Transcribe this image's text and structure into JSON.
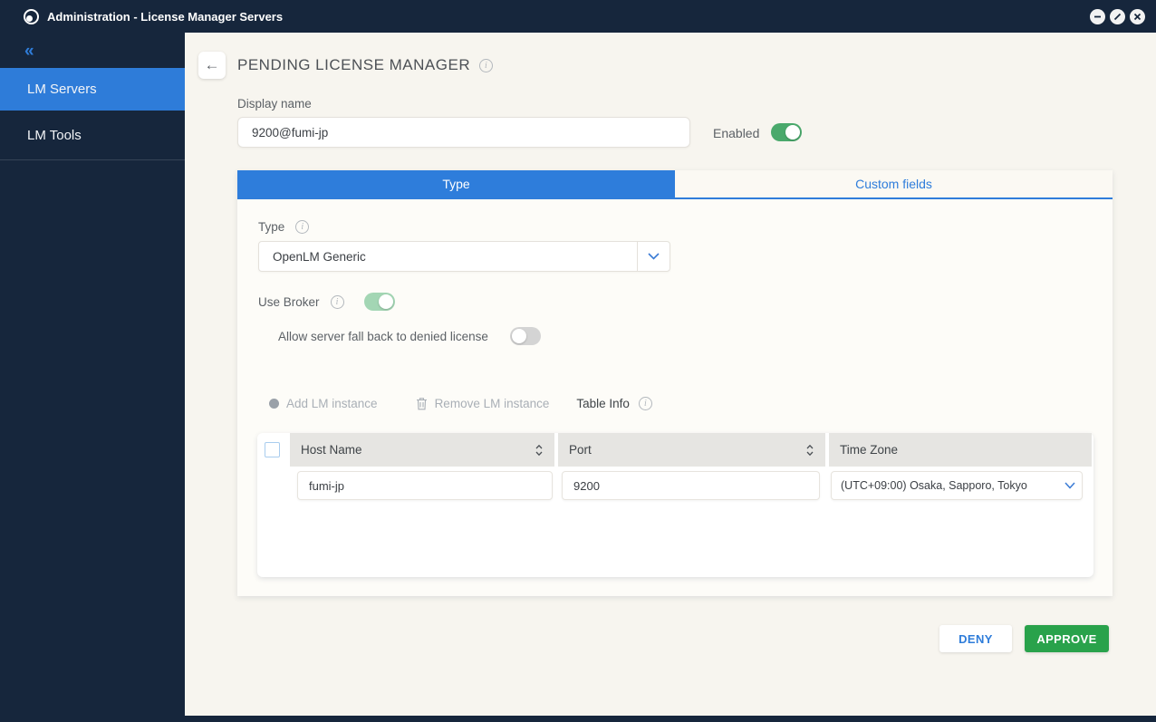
{
  "window": {
    "title": "Administration - License Manager Servers"
  },
  "sidebar": {
    "collapse_icon": "«",
    "items": [
      {
        "label": "LM Servers",
        "active": true
      },
      {
        "label": "LM Tools",
        "active": false
      }
    ]
  },
  "page": {
    "title": "PENDING LICENSE MANAGER",
    "display_name": {
      "label": "Display name",
      "value": "9200@fumi-jp"
    },
    "enabled_toggle": {
      "label": "Enabled",
      "state": "on"
    },
    "tabs": [
      {
        "label": "Type",
        "active": true
      },
      {
        "label": "Custom fields",
        "active": false
      }
    ],
    "type_section": {
      "type_label": "Type",
      "type_value": "OpenLM Generic",
      "use_broker_label": "Use Broker",
      "use_broker_state": "on",
      "fallback_label": "Allow server fall back to denied license",
      "fallback_state": "off"
    },
    "table_toolbar": {
      "add_label": "Add LM instance",
      "remove_label": "Remove LM instance",
      "info_label": "Table Info"
    },
    "table": {
      "columns": [
        {
          "label": "Host Name",
          "sortable": true
        },
        {
          "label": "Port",
          "sortable": true
        },
        {
          "label": "Time Zone",
          "sortable": false
        }
      ],
      "rows": [
        {
          "host_name": "fumi-jp",
          "port": "9200",
          "time_zone": "(UTC+09:00) Osaka, Sapporo, Tokyo"
        }
      ]
    },
    "actions": {
      "deny": "DENY",
      "approve": "APPROVE"
    }
  },
  "colors": {
    "titlebar_bg": "#16263c",
    "accent_blue": "#2e7cd9",
    "toggle_on_green": "#4aa96c",
    "toggle_on_light_green": "#a3d6b4",
    "toggle_off_gray": "#d4d4d4",
    "approve_green": "#29a24b",
    "page_bg": "#f7f5ef",
    "panel_bg": "#fdfcf8",
    "table_header_bg": "#e6e5e2"
  }
}
